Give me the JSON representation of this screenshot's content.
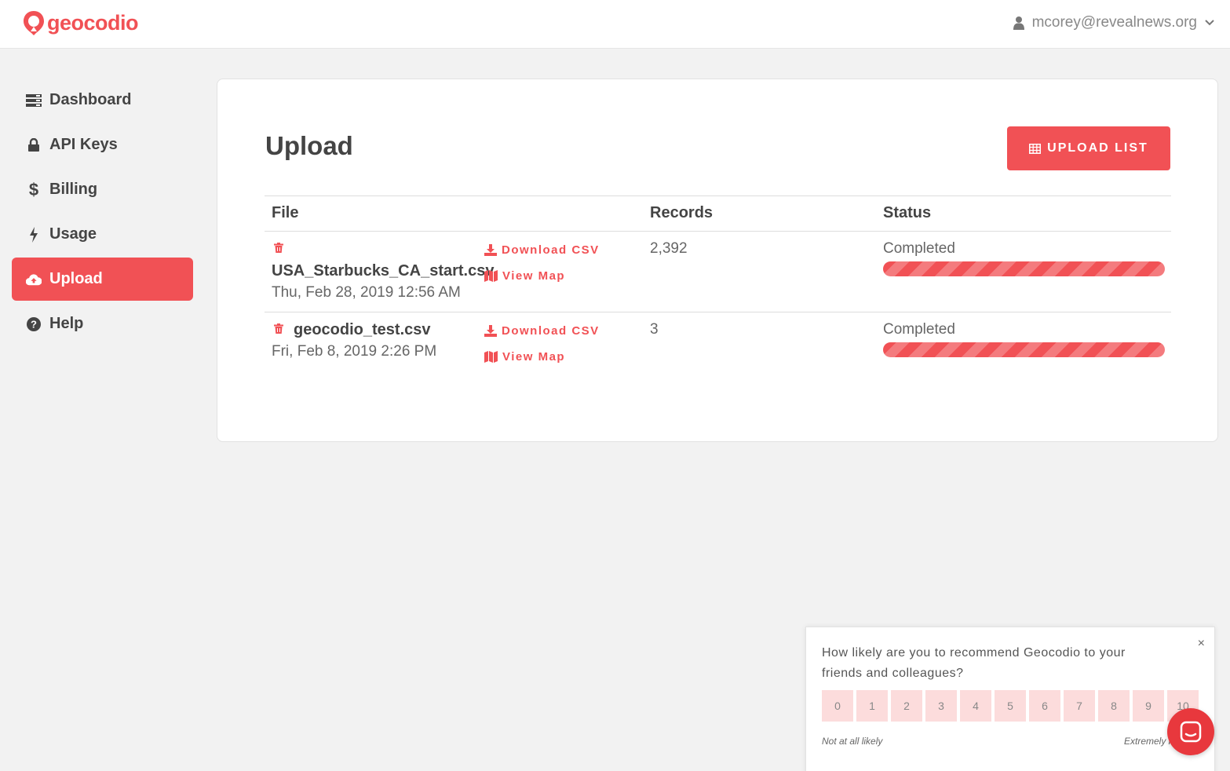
{
  "brand": {
    "name": "geocodio",
    "accent": "#f15155"
  },
  "user": {
    "email": "mcorey@revealnews.org"
  },
  "sidebar": {
    "items": [
      {
        "label": "Dashboard",
        "icon": "server-icon"
      },
      {
        "label": "API Keys",
        "icon": "lock-icon"
      },
      {
        "label": "Billing",
        "icon": "dollar-icon"
      },
      {
        "label": "Usage",
        "icon": "bolt-icon"
      },
      {
        "label": "Upload",
        "icon": "cloud-upload-icon",
        "active": true
      },
      {
        "label": "Help",
        "icon": "question-circle-icon"
      }
    ]
  },
  "main": {
    "title": "Upload",
    "upload_button": "UPLOAD LIST",
    "columns": {
      "file": "File",
      "records": "Records",
      "status": "Status"
    },
    "rows": [
      {
        "filename": "USA_Starbucks_CA_start.csv",
        "date": "Thu, Feb 28, 2019 12:56 AM",
        "download_label": "Download CSV",
        "map_label": "View Map",
        "records": "2,392",
        "status": "Completed",
        "progress": 1.0
      },
      {
        "filename": "geocodio_test.csv",
        "date": "Fri, Feb 8, 2019 2:26 PM",
        "download_label": "Download CSV",
        "map_label": "View Map",
        "records": "3",
        "status": "Completed",
        "progress": 1.0
      }
    ]
  },
  "nps": {
    "question": "How likely are you to recommend Geocodio to your friends and colleagues?",
    "options": [
      "0",
      "1",
      "2",
      "3",
      "4",
      "5",
      "6",
      "7",
      "8",
      "9",
      "10"
    ],
    "low_label": "Not at all likely",
    "high_label": "Extremely likely",
    "close": "×"
  }
}
